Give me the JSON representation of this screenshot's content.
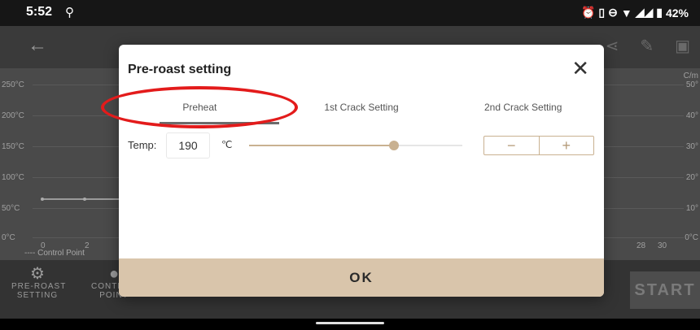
{
  "status": {
    "time": "5:52",
    "battery": "42%"
  },
  "chart_bg": {
    "yticks_left": [
      "250°C",
      "200°C",
      "150°C",
      "100°C",
      "50°C",
      "0°C"
    ],
    "yticks_right": [
      "C/m",
      "50°",
      "40°",
      "30°",
      "20°",
      "10°",
      "0°C"
    ],
    "xticks": [
      "0",
      "2",
      "28",
      "30"
    ],
    "legend": "---- Control Point"
  },
  "bottom": {
    "preroast_label": "PRE-ROAST\nSETTING",
    "control_label": "CONTROL\nPOINT",
    "start": "START"
  },
  "dialog": {
    "title": "Pre-roast setting",
    "tabs": [
      "Preheat",
      "1st Crack Setting",
      "2nd Crack Setting"
    ],
    "active_tab": 0,
    "temp_label": "Temp:",
    "temp_value": "190",
    "temp_unit": "℃",
    "slider_level": 0.68,
    "ok": "OK"
  },
  "colors": {
    "accent": "#c9b191",
    "ok_bg": "#d9c5ab",
    "highlight": "#e31b1b"
  }
}
